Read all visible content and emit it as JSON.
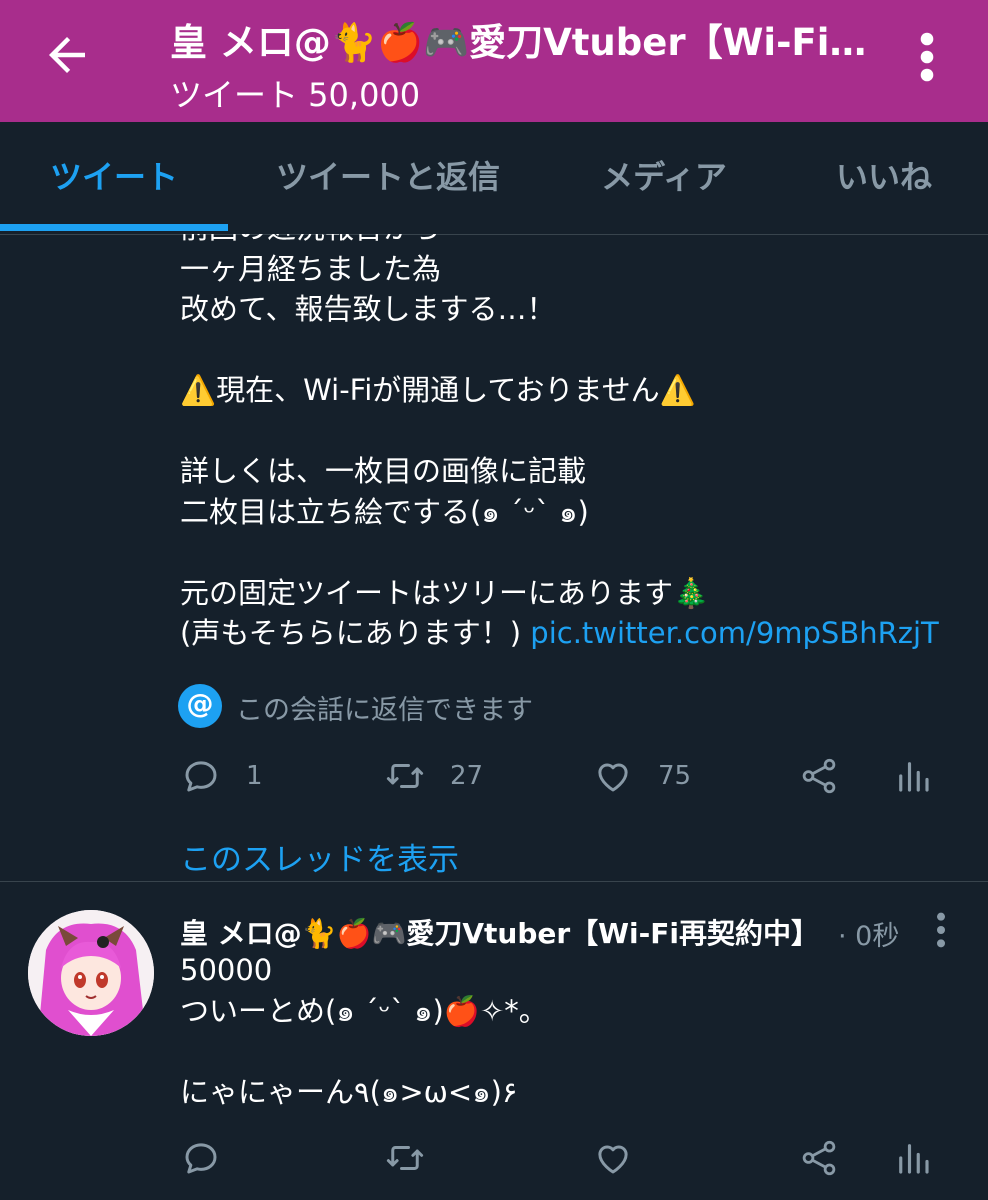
{
  "header": {
    "title": "皇 メロ@🐈🍎🎮愛刀Vtuber【Wi-Fi再契約中】",
    "subtitle": "ツイート 50,000"
  },
  "tabs": [
    {
      "label": "ツイート",
      "active": true
    },
    {
      "label": "ツイートと返信",
      "active": false
    },
    {
      "label": "メディア",
      "active": false
    },
    {
      "label": "いいね",
      "active": false
    }
  ],
  "tweet1": {
    "text": "前回の近況報告から\n一ヶ月経ちました為\n改めて、報告致しまする…！\n\n⚠️現在、Wi-Fiが開通しておりません⚠️\n\n詳しくは、一枚目の画像に記載\n二枚目は立ち絵でする(๑ ´ᵕ` ๑)\n\n元の固定ツイートはツリーにあります🎄\n(声もそちらにあります！) ",
    "link": "pic.twitter.com/9mpSBhRzjT",
    "reply_notice": "この会話に返信できます",
    "reply_at": "@",
    "replies": "1",
    "retweets": "27",
    "likes": "75",
    "show_thread": "このスレッドを表示"
  },
  "tweet2": {
    "name": "皇 メロ@🐈🍎🎮愛刀Vtuber【Wi-Fi再契約中】",
    "time": "· 0秒",
    "text": "50000\nついーとめ(๑ ´ᵕ` ๑)🍎✧*。\n\nにゃにゃーん٩(๑>ω<๑)۶"
  },
  "colors": {
    "header_bg": "#a82d8c",
    "background": "#15202b",
    "accent": "#1da1f2",
    "muted": "#8899a6"
  },
  "icons": [
    "back-arrow-icon",
    "more-vert-icon",
    "reply-icon",
    "retweet-icon",
    "like-icon",
    "share-icon",
    "analytics-icon",
    "at-mention-icon"
  ]
}
